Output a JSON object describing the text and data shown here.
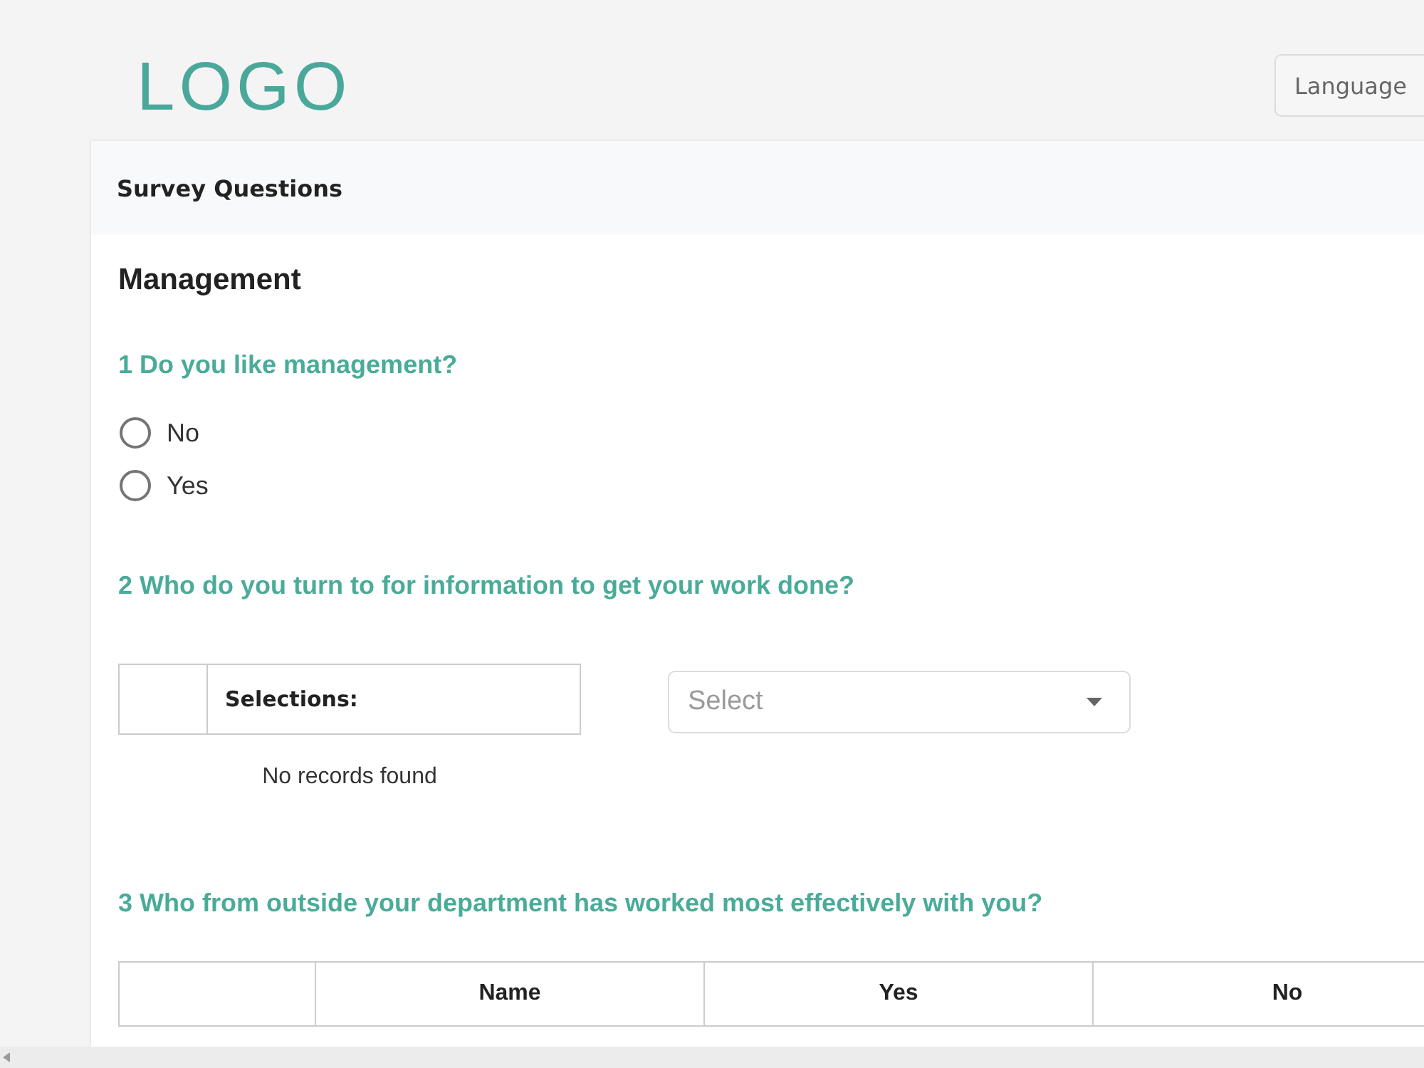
{
  "header": {
    "logo": "LOGO",
    "language_button": "Language"
  },
  "card": {
    "title": "Survey Questions",
    "section_title": "Management"
  },
  "questions": [
    {
      "kind": "radio",
      "text": "1 Do you like management?",
      "options": [
        {
          "label": "No",
          "selected": false
        },
        {
          "label": "Yes",
          "selected": false
        }
      ]
    },
    {
      "kind": "selection",
      "text": "2 Who do you turn to for information to get your work done?",
      "table": {
        "columns": [
          "Selections:"
        ],
        "empty_message": "No records found"
      },
      "select": {
        "placeholder": "Select"
      }
    },
    {
      "kind": "grid",
      "text": "3 Who from outside your department has worked most effectively with you?",
      "table": {
        "columns": [
          "Name",
          "Yes",
          "No"
        ]
      }
    }
  ]
}
